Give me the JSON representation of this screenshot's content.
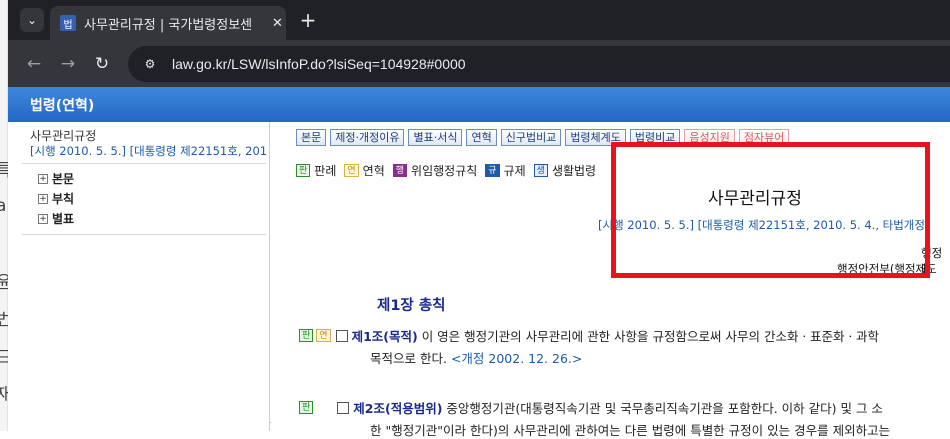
{
  "browser": {
    "tab_title": "사무관리규정 | 국가법령정보센",
    "favicon_text": "법",
    "url": "law.go.kr/LSW/lsInfoP.do?lsiSeq=104928#0000"
  },
  "background_glyphs": [
    "특",
    "a",
    "l",
    "윤",
    "번",
    "드",
    "재"
  ],
  "header": {
    "title": "법령(연혁)"
  },
  "left_panel": {
    "law_name": "사무관리규정",
    "law_date": "[시행 2010. 5. 5.] [대통령령 제22151호, 201",
    "tree": [
      {
        "label": "본문"
      },
      {
        "label": "부칙"
      },
      {
        "label": "별표"
      }
    ]
  },
  "toolbar_buttons": [
    {
      "label": "본문"
    },
    {
      "label": "제정·개정이유"
    },
    {
      "label": "별표·서식"
    },
    {
      "label": "연혁"
    },
    {
      "label": "신구법비교"
    },
    {
      "label": "법령체계도"
    },
    {
      "label": "법령비교"
    },
    {
      "label": "음성지원"
    },
    {
      "label": "점자뷰어"
    }
  ],
  "legend": [
    {
      "badge": "판",
      "label": "판례",
      "color": "#2e8b2e"
    },
    {
      "badge": "연",
      "label": "연혁",
      "color": "#c28a00"
    },
    {
      "badge": "행",
      "label": "위임행정규칙",
      "color": "#8a2e8a"
    },
    {
      "badge": "규",
      "label": "규제",
      "color": "#1c5ca8"
    },
    {
      "badge": "생",
      "label": "생활법령",
      "color": "#1c5ca8"
    }
  ],
  "document": {
    "title": "사무관리규정",
    "date_line": "[시행 2010. 5. 5.] [대통령령 제22151호, 2010. 5. 4., 타법개정]",
    "ministry_line1": "행정안",
    "ministry_line2": "행정안전부(행정제도",
    "chapter": "제1장 총칙",
    "articles": [
      {
        "badges": [
          "판",
          "연"
        ],
        "heading": "제1조(목적)",
        "text": "이 영은 행정기관의 사무관리에 관한 사항을 규정함으로써 사무의 간소화ㆍ표준화ㆍ과학",
        "continuation": "목적으로 한다.",
        "amendment": "<개정 2002. 12. 26.>"
      },
      {
        "badges": [
          "판"
        ],
        "heading": "제2조(적용범위)",
        "text": "중앙행정기관(대통령직속기관 및 국무총리직속기관을 포함한다. 이하 같다) 및 그 소",
        "continuation": "한 \"행정기관\"이라 한다)의 사무관리에 관하여는 다른 법령에 특별한 규정이 있는 경우를 제외하고는"
      }
    ]
  },
  "colors": {
    "header_blue": "#2269c4",
    "highlight_red": "#e8141c",
    "article_blue": "#1a2a8a"
  }
}
